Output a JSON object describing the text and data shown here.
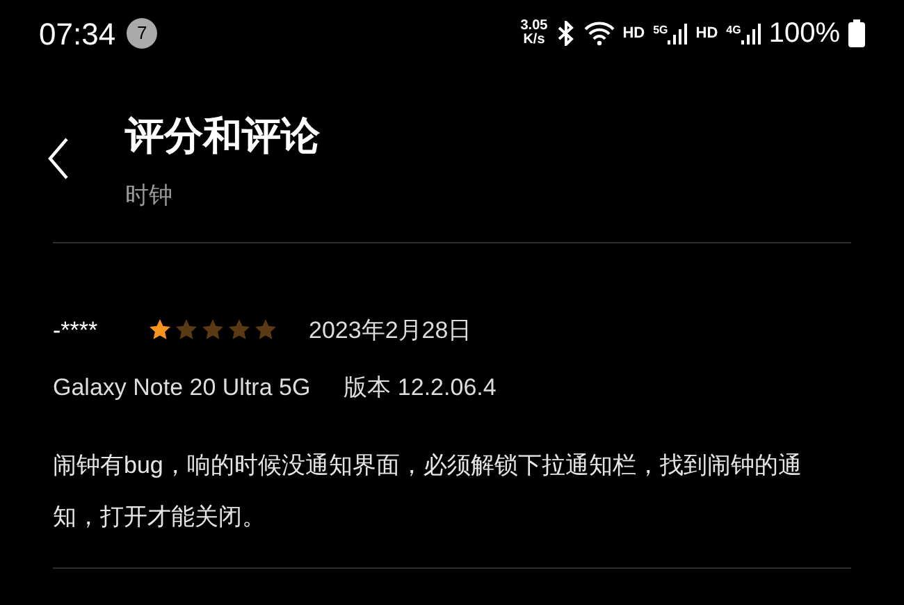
{
  "status_bar": {
    "time": "07:34",
    "notification_count": "7",
    "speed_value": "3.05",
    "speed_unit": "K/s",
    "hd_1": "HD",
    "network_1": "5G",
    "hd_2": "HD",
    "network_2": "4G",
    "battery": "100%"
  },
  "header": {
    "title": "评分和评论",
    "subtitle": "时钟"
  },
  "reviews": [
    {
      "author": "-****",
      "stars": 1,
      "date": "2023年2月28日",
      "device": "Galaxy Note 20 Ultra 5G",
      "version": "版本 12.2.06.4",
      "text": "闹钟有bug，响的时候没通知界面，必须解锁下拉通知栏，找到闹钟的通知，打开才能关闭。"
    }
  ]
}
